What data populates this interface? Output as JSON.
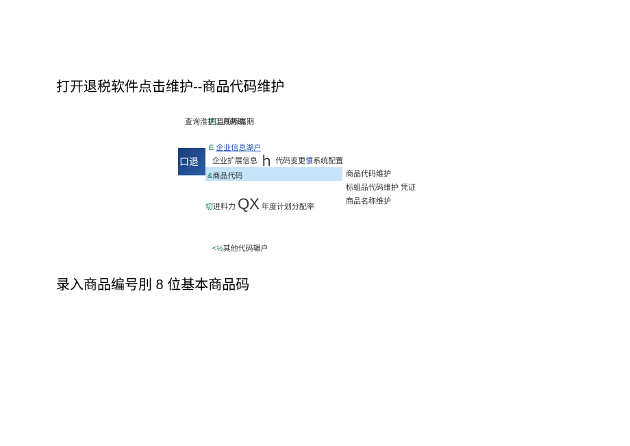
{
  "heading1": "打开退税软件点击维护--商品代码维护",
  "heading2": "录入商品编号刖 8 位基本商品码",
  "menu": {
    "topbar": "查询淮护工具帮助",
    "line_period_prefix": "国",
    "line_period": "当前所属期",
    "line_e_prefix": "E",
    "line_enterprise_info": "企业信息湖户",
    "line_ext_info": "企业扩展信息",
    "letter_h": "ｈ",
    "line_code_change_prefix": "代码变更",
    "line_code_change_mid": "憤",
    "line_sys_config": "系统配置",
    "blue_box_text": "口退",
    "amp_prefix": "&",
    "product_code": "商品代码",
    "cut_text": "切",
    "feed_text": "进料力",
    "qx": "QX",
    "year_plan": "年度计划分配率",
    "other_prefix": "<½",
    "other_code": "其他代码辗户"
  },
  "submenu": {
    "item1": "商品代码维护",
    "item2": "标蛆品代码维护 凭证",
    "item3": "商品名称维护"
  }
}
